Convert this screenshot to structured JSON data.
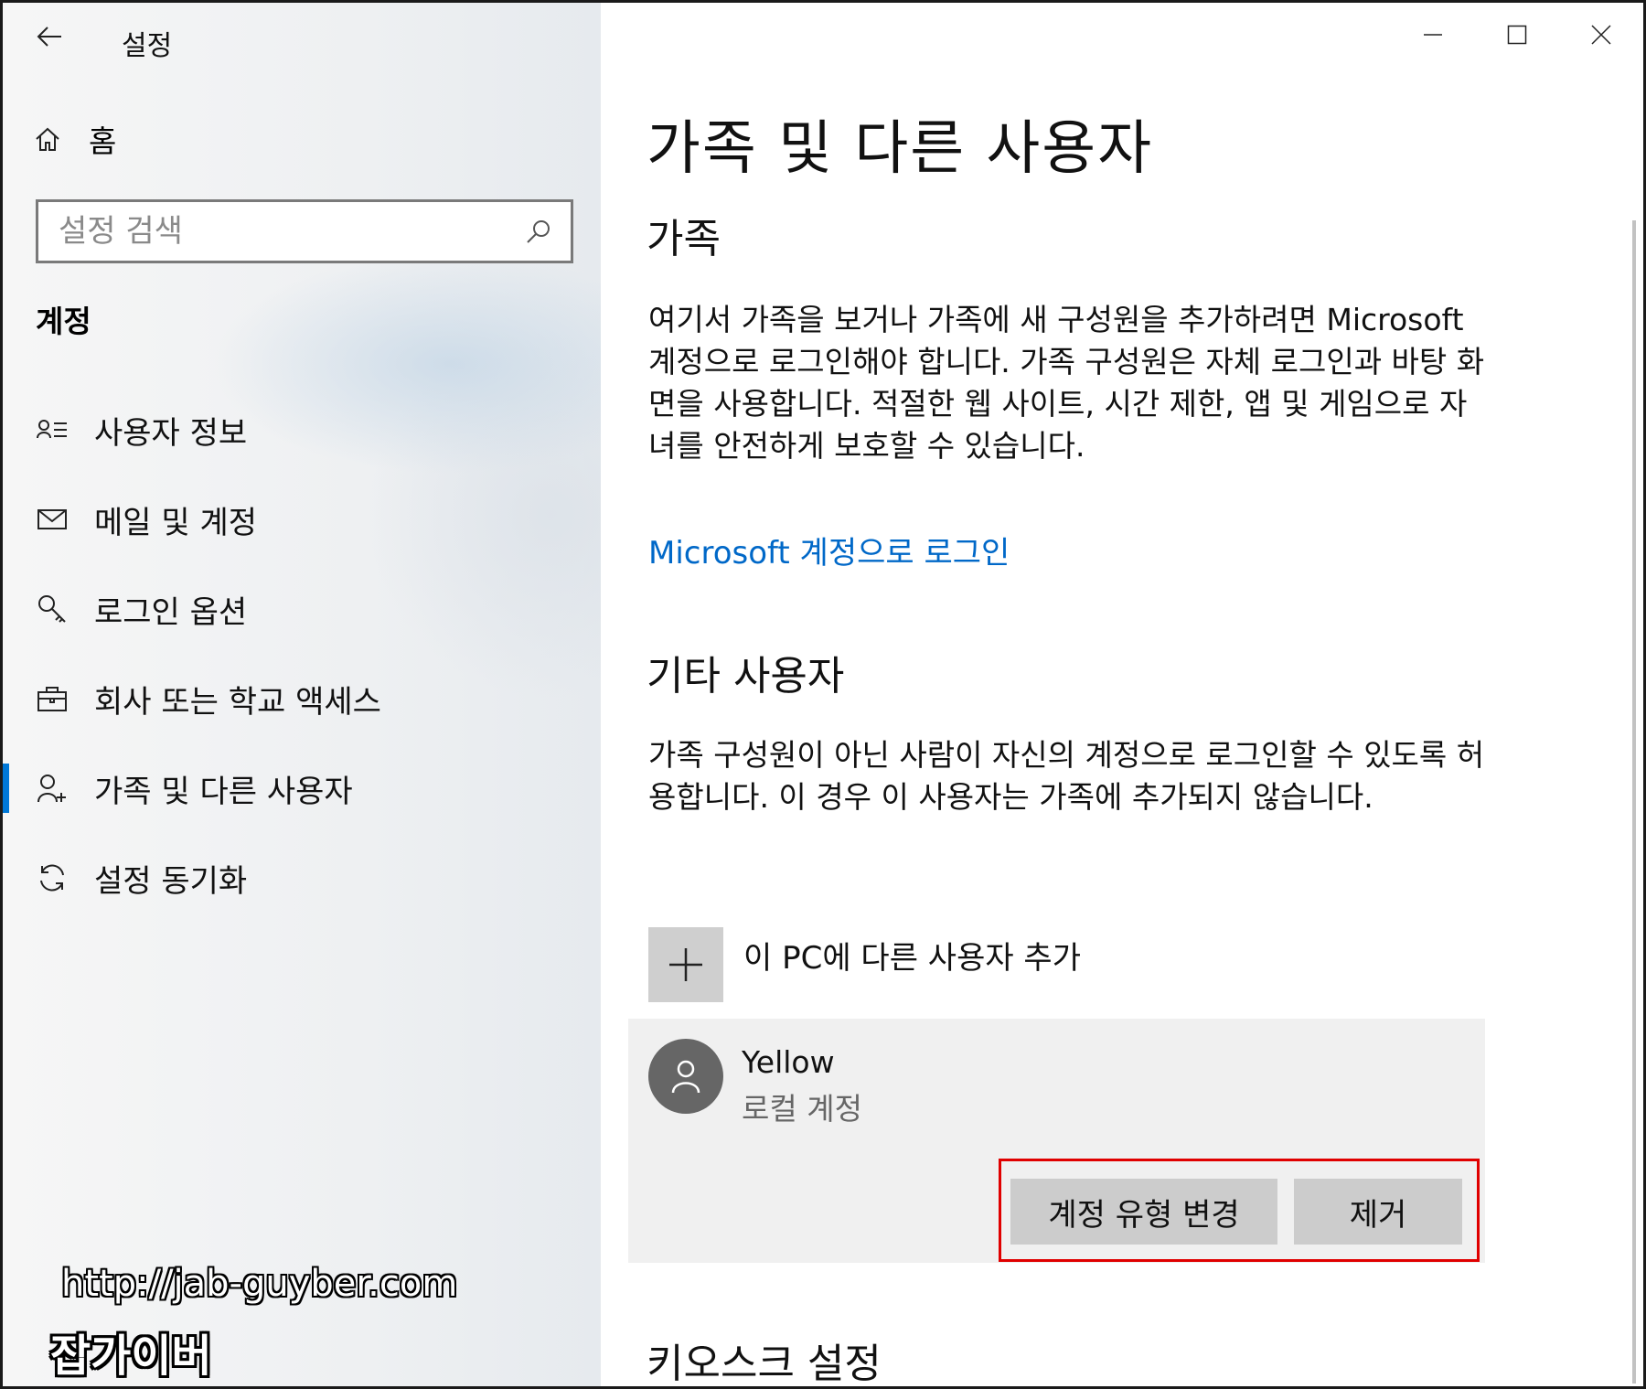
{
  "app": {
    "title": "설정"
  },
  "nav": {
    "home_label": "홈",
    "search_placeholder": "설정 검색",
    "section_heading": "계정",
    "items": [
      {
        "label": "사용자 정보",
        "icon": "user-info-icon"
      },
      {
        "label": "메일 및 계정",
        "icon": "mail-icon"
      },
      {
        "label": "로그인 옵션",
        "icon": "key-icon"
      },
      {
        "label": "회사 또는 학교 액세스",
        "icon": "briefcase-icon"
      },
      {
        "label": "가족 및 다른 사용자",
        "icon": "add-user-icon",
        "active": true
      },
      {
        "label": "설정 동기화",
        "icon": "sync-icon"
      }
    ]
  },
  "main": {
    "title": "가족 및 다른 사용자",
    "family": {
      "heading": "가족",
      "description": "여기서 가족을 보거나 가족에 새 구성원을 추가하려면 Microsoft 계정으로 로그인해야 합니다. 가족 구성원은 자체 로그인과 바탕 화면을 사용합니다. 적절한 웹 사이트, 시간 제한, 앱 및 게임으로 자녀를 안전하게 보호할 수 있습니다.",
      "link": "Microsoft 계정으로 로그인"
    },
    "other_users": {
      "heading": "기타 사용자",
      "description": "가족 구성원이 아닌 사람이 자신의 계정으로 로그인할 수 있도록 허용합니다. 이 경우 이 사용자는 가족에 추가되지 않습니다.",
      "add_label": "이 PC에 다른 사용자 추가",
      "user": {
        "name": "Yellow",
        "type": "로컬 계정",
        "change_type_button": "계정 유형 변경",
        "remove_button": "제거"
      }
    },
    "kiosk_heading": "키오스크 설정"
  },
  "watermark": {
    "url": "http://jab-guyber.com",
    "brand": "잡가이버"
  },
  "colors": {
    "accent": "#0078d7",
    "link": "#0068c8",
    "highlight": "#e00000"
  }
}
